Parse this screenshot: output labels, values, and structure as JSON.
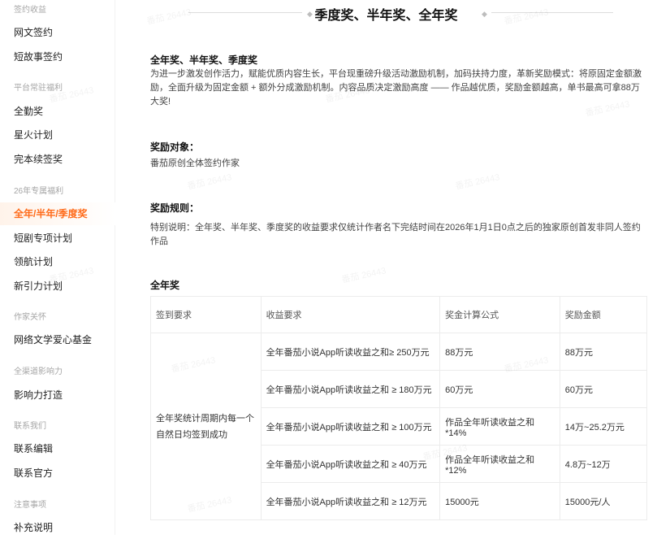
{
  "sidebar": {
    "groups": [
      {
        "title": "签约收益",
        "items": [
          {
            "label": "网文签约"
          },
          {
            "label": "短故事签约"
          }
        ]
      },
      {
        "title": "平台常驻福利",
        "items": [
          {
            "label": "全勤奖"
          },
          {
            "label": "星火计划"
          },
          {
            "label": "完本续签奖"
          }
        ]
      },
      {
        "title": "26年专属福利",
        "items": [
          {
            "label": "全年/半年/季度奖",
            "active": true
          },
          {
            "label": "短剧专项计划"
          },
          {
            "label": "领航计划"
          },
          {
            "label": "新引力计划"
          }
        ]
      },
      {
        "title": "作家关怀",
        "items": [
          {
            "label": "网络文学爱心基金"
          }
        ]
      },
      {
        "title": "全渠道影响力",
        "items": [
          {
            "label": "影响力打造"
          }
        ]
      },
      {
        "title": "联系我们",
        "items": [
          {
            "label": "联系编辑"
          },
          {
            "label": "联系官方"
          }
        ]
      },
      {
        "title": "注意事项",
        "items": [
          {
            "label": "补充说明"
          }
        ]
      }
    ]
  },
  "main": {
    "title": "季度奖、半年奖、全年奖",
    "section_heading": "全年奖、半年奖、季度奖",
    "intro": "为进一步激发创作活力，赋能优质内容生长，平台现重磅升级活动激励机制，加码扶持力度，革新奖励模式：将原固定金额激励，全面升级为固定金额 + 额外分成激励机制。内容品质决定激励高度 —— 作品越优质，奖励金额越高，单书最高可拿88万大奖!",
    "target_heading": "奖励对象：",
    "target_text": "番茄原创全体签约作家",
    "rules_heading": "奖励规则：",
    "rules_text": "特别说明：全年奖、半年奖、季度奖的收益要求仅统计作者名下完结时间在2026年1月1日0点之后的独家原创首发非同人签约作品",
    "annual_heading": "全年奖",
    "table": {
      "headers": [
        "签到要求",
        "收益要求",
        "奖金计算公式",
        "奖励金额"
      ],
      "signin": "全年奖统计周期内每一个自然日均签到成功",
      "rows": [
        {
          "req": "全年番茄小说App听读收益之和≥ 250万元",
          "formula": "88万元",
          "amount": "88万元"
        },
        {
          "req": "全年番茄小说App听读收益之和 ≥ 180万元",
          "formula": "60万元",
          "amount": "60万元"
        },
        {
          "req": "全年番茄小说App听读收益之和 ≥ 100万元",
          "formula": "作品全年听读收益之和*14%",
          "amount": "14万~25.2万元"
        },
        {
          "req": "全年番茄小说App听读收益之和 ≥ 40万元",
          "formula": "作品全年听读收益之和*12%",
          "amount": "4.8万~12万"
        },
        {
          "req": "全年番茄小说App听读收益之和 ≥ 12万元",
          "formula": "15000元",
          "amount": "15000元/人"
        }
      ]
    }
  },
  "watermark": "番茄 26443",
  "colors": {
    "accent": "#ff6b1a"
  }
}
